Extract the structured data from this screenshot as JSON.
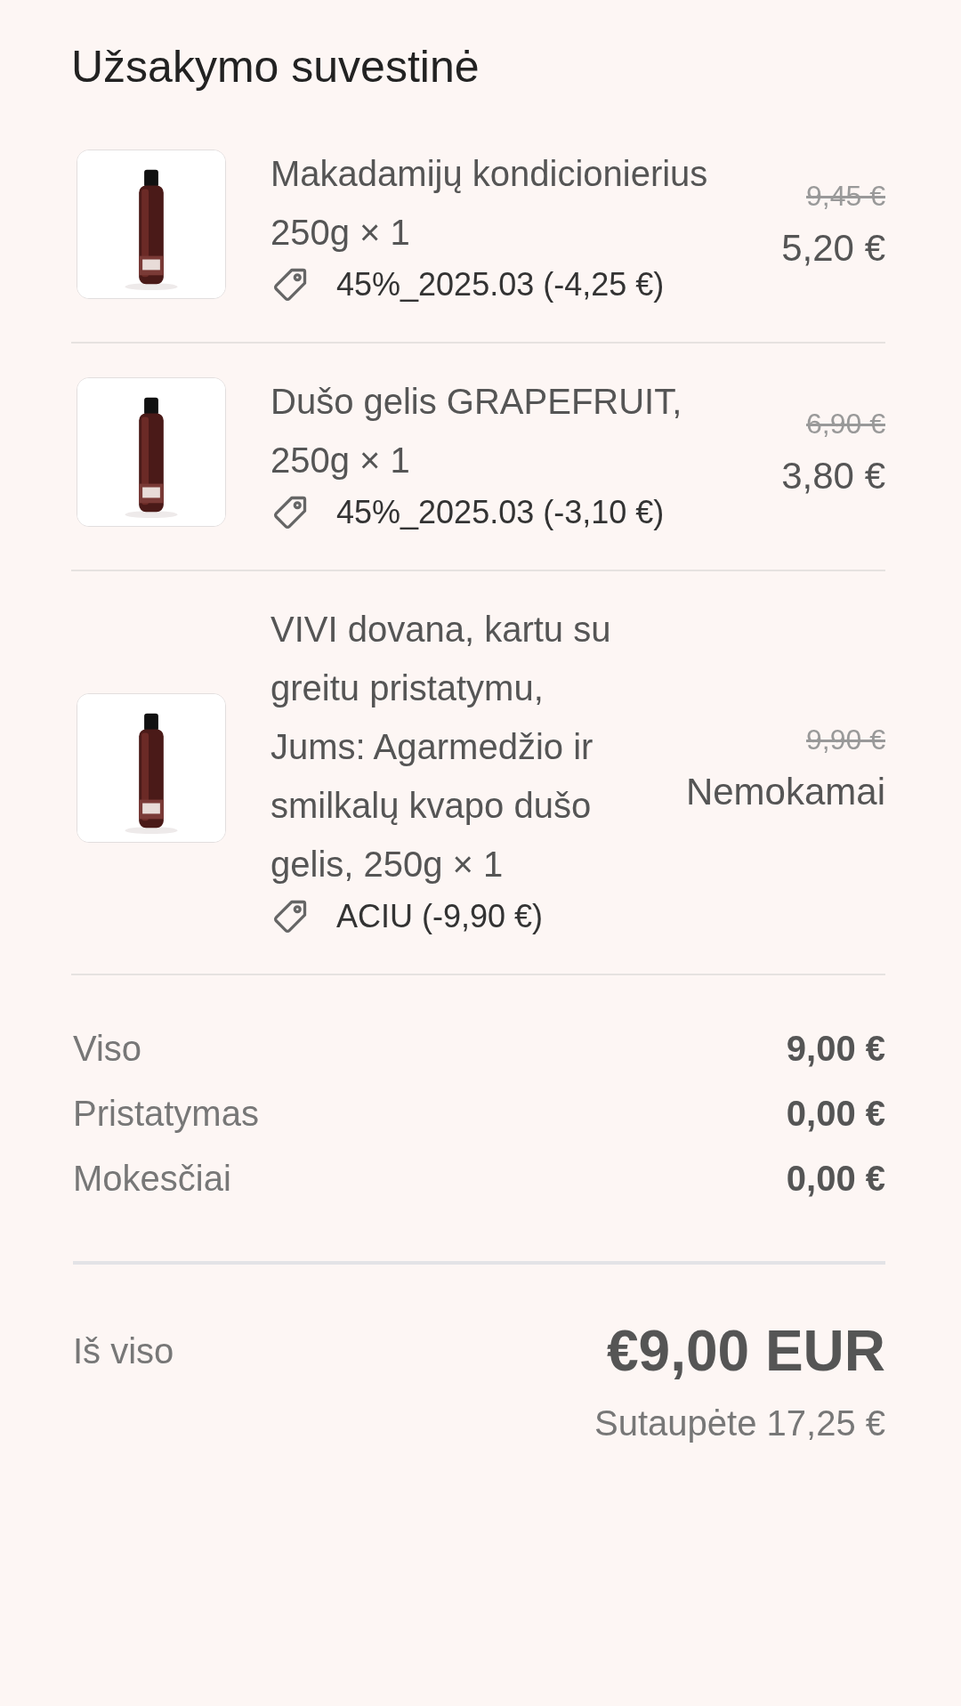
{
  "title": "Užsakymo suvestinė",
  "items": [
    {
      "name": "Makadamijų kondicionierius 250g × 1",
      "discount": "45%_2025.03 (-4,25 €)",
      "original_price": "9,45 €",
      "price": "5,20 €"
    },
    {
      "name": "Dušo gelis GRAPEFRUIT, 250g × 1",
      "discount": "45%_2025.03 (-3,10 €)",
      "original_price": "6,90 €",
      "price": "3,80 €"
    },
    {
      "name": "VIVI dovana, kartu su greitu pristatymu, Jums: Agarmedžio ir smilkalų kvapo dušo gelis, 250g × 1",
      "discount": "ACIU (-9,90 €)",
      "original_price": "9,90 €",
      "price": "Nemokamai"
    }
  ],
  "summary": [
    {
      "label": "Viso",
      "value": "9,00 €"
    },
    {
      "label": "Pristatymas",
      "value": "0,00 €"
    },
    {
      "label": "Mokesčiai",
      "value": "0,00 €"
    }
  ],
  "total": {
    "label": "Iš viso",
    "value": "€9,00 EUR",
    "savings": "Sutaupėte 17,25 €"
  }
}
